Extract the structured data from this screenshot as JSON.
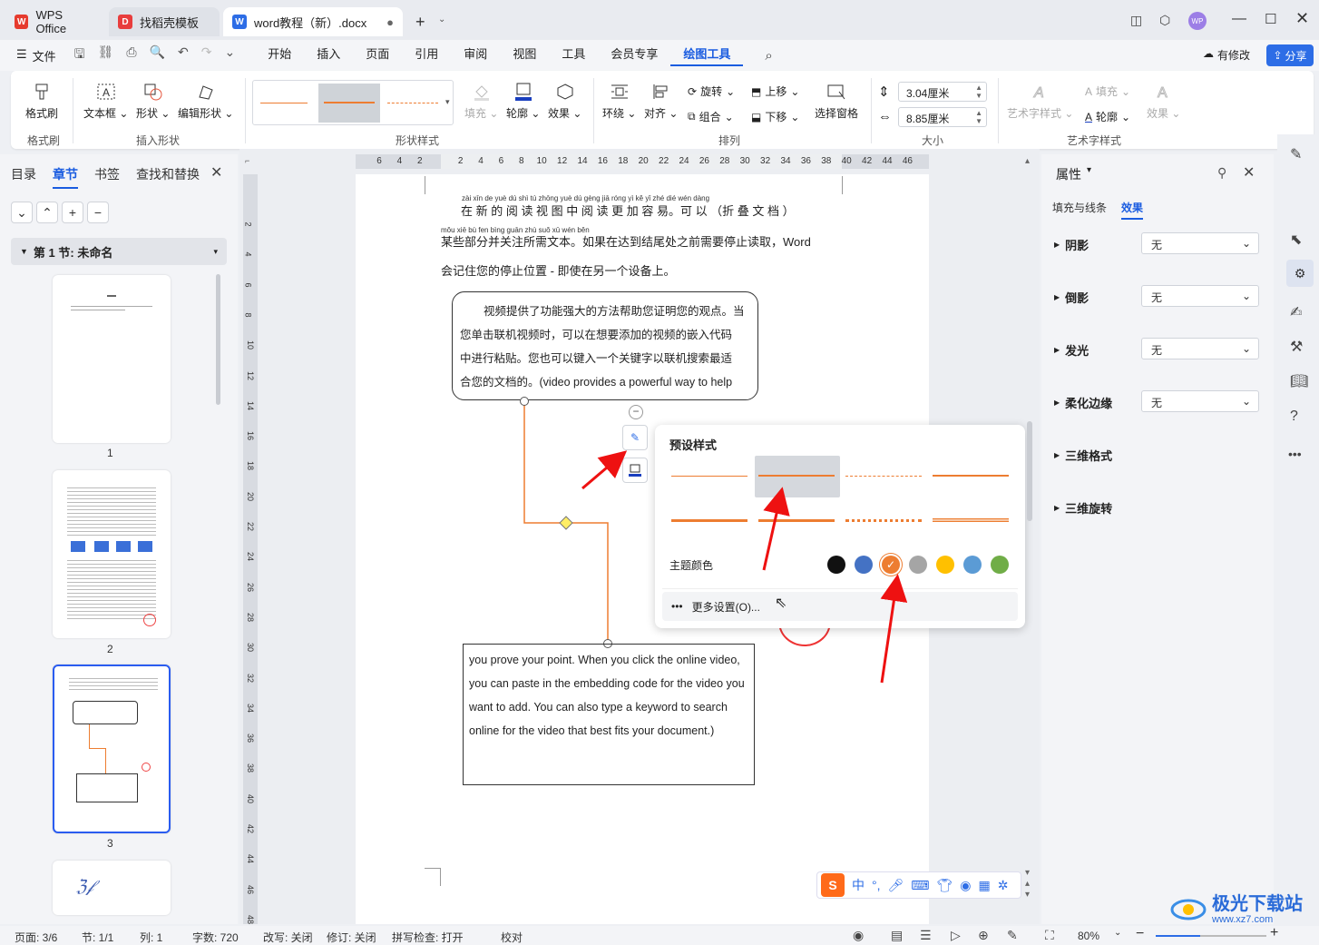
{
  "tabs": [
    {
      "label": "WPS Office",
      "icon": "wps-logo-icon"
    },
    {
      "label": "找稻壳模板",
      "icon": "daoke-icon"
    },
    {
      "label": "word教程（新）.docx",
      "icon": "word-doc-icon"
    }
  ],
  "menu": {
    "file": "文件",
    "items": [
      "开始",
      "插入",
      "页面",
      "引用",
      "审阅",
      "视图",
      "工具",
      "会员专享",
      "绘图工具"
    ],
    "active": "绘图工具",
    "modified": "有修改",
    "share": "分享"
  },
  "ribbon": {
    "format_painter": "格式刷",
    "format_painter_group": "格式刷",
    "textbox": "文本框",
    "shape": "形状",
    "edit_shape": "编辑形状",
    "insert_shape_group": "插入形状",
    "shape_style_group": "形状样式",
    "fill": "填充",
    "outline": "轮廓",
    "effect": "效果",
    "wrap": "环绕",
    "align": "对齐",
    "rotate": "旋转",
    "group": "组合",
    "move_up": "上移",
    "move_down": "下移",
    "select_pane": "选择窗格",
    "arrange_group": "排列",
    "height": "3.04厘米",
    "width": "8.85厘米",
    "size_group": "大小",
    "art_style": "艺术字样式",
    "art_fill": "填充",
    "art_outline": "轮廓",
    "art_effect": "效果",
    "art_group": "艺术字样式"
  },
  "left_panel": {
    "tabs": [
      "目录",
      "章节",
      "书签",
      "查找和替换"
    ],
    "active": "章节",
    "section": "第 1 节: 未命名",
    "pages": [
      "1",
      "2",
      "3"
    ]
  },
  "ruler_h": [
    "6",
    "4",
    "2",
    "",
    "2",
    "4",
    "6",
    "8",
    "10",
    "12",
    "14",
    "16",
    "18",
    "20",
    "22",
    "24",
    "26",
    "28",
    "30",
    "32",
    "34",
    "36",
    "38",
    "40",
    "42",
    "44",
    "46"
  ],
  "ruler_v": [
    "2",
    "4",
    "6",
    "8",
    "10",
    "12",
    "14",
    "16",
    "18",
    "20",
    "22",
    "24",
    "26",
    "28",
    "30",
    "32",
    "34",
    "36",
    "38",
    "40",
    "42",
    "44",
    "46",
    "48"
  ],
  "doc": {
    "pinyin1": "zài  xīn  de  yuè  dú  shì  tú  zhōng  yuè  dú  gèng  jiā  róng  yì         kě  yǐ        zhé  dié  wén  dàng",
    "line1": "在 新 的 阅 读 视 图 中 阅 读 更 加 容 易。可 以 （折 叠 文 档 ）",
    "pinyin2": "mǒu xiē bù fen bìng guān zhù suǒ xū wén běn",
    "line2": "某些部分并关注所需文本。如果在达到结尾处之前需要停止读取，Word",
    "line3": "会记住您的停止位置 - 即使在另一个设备上。",
    "box1": [
      "视频提供了功能强大的方法帮助您证明您的观点。当",
      "您单击联机视频时，可以在想要添加的视频的嵌入代码",
      "中进行粘贴。您也可以键入一个关键字以联机搜索最适",
      "合您的文档的。(video provides a powerful way to help"
    ],
    "box2": [
      "you prove your point. When you click the online video,",
      "you can paste in the embedding code for the video you",
      "want to add. You can also type a keyword to search",
      "online for the video that best fits your document.)"
    ]
  },
  "popup": {
    "title": "预设样式",
    "theme_color": "主题颜色",
    "more": "更多设置(O)...",
    "colors": [
      "#111111",
      "#4472c4",
      "#ed7d31",
      "#a5a5a5",
      "#ffc000",
      "#5b9bd5",
      "#70ad47"
    ]
  },
  "right_panel": {
    "title": "属性",
    "tabs": [
      "填充与线条",
      "效果"
    ],
    "active": "效果",
    "rows": [
      {
        "label": "阴影",
        "value": "无"
      },
      {
        "label": "倒影",
        "value": "无"
      },
      {
        "label": "发光",
        "value": "无"
      },
      {
        "label": "柔化边缘",
        "value": "无"
      },
      {
        "label": "三维格式",
        "value": ""
      },
      {
        "label": "三维旋转",
        "value": ""
      }
    ]
  },
  "status": {
    "page": "页面: 3/6",
    "section": "节: 1/1",
    "col": "列: 1",
    "words": "字数: 720",
    "rewrite": "改写: 关闭",
    "revise": "修订: 关闭",
    "spell": "拼写检查: 打开",
    "proof": "校对",
    "zoom": "80%"
  },
  "watermark": {
    "text": "极光下载站",
    "url": "www.xz7.com"
  },
  "ime": {
    "lang": "中"
  }
}
